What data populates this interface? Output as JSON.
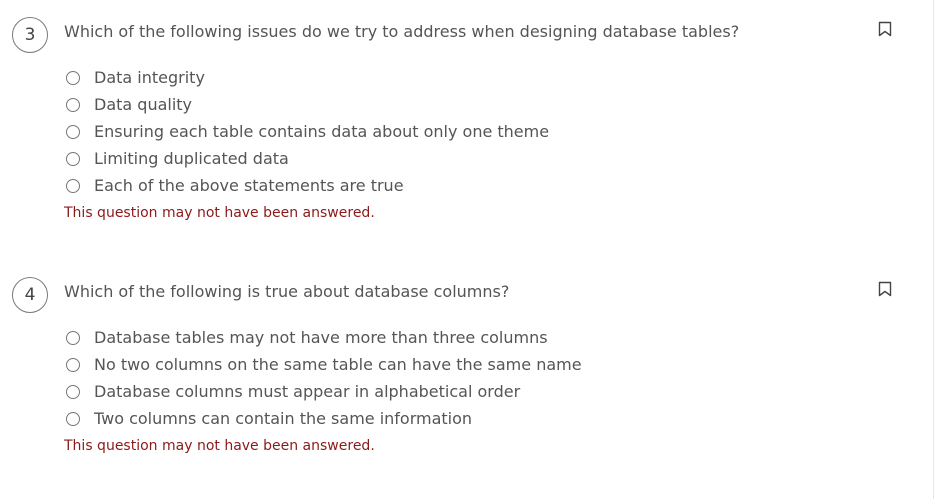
{
  "questions": [
    {
      "number": "3",
      "text": "Which of the following issues do we try to address when designing database tables?",
      "options": [
        "Data integrity",
        "Data quality",
        "Ensuring each table contains data about only one theme",
        "Limiting duplicated data",
        "Each of the above statements are true"
      ],
      "warning": "This question may not have been answered.",
      "bookmark_icon": "bookmark-outline"
    },
    {
      "number": "4",
      "text": "Which of the following is true about database columns?",
      "options": [
        "Database tables may not have more than three columns",
        "No two columns on the same table can have the same name",
        "Database columns must appear in alphabetical order",
        "Two columns can contain the same information"
      ],
      "warning": "This question may not have been answered.",
      "bookmark_icon": "bookmark-outline"
    }
  ],
  "colors": {
    "text": "#555555",
    "warning": "#8b1a1a",
    "radio_border": "#777777"
  }
}
